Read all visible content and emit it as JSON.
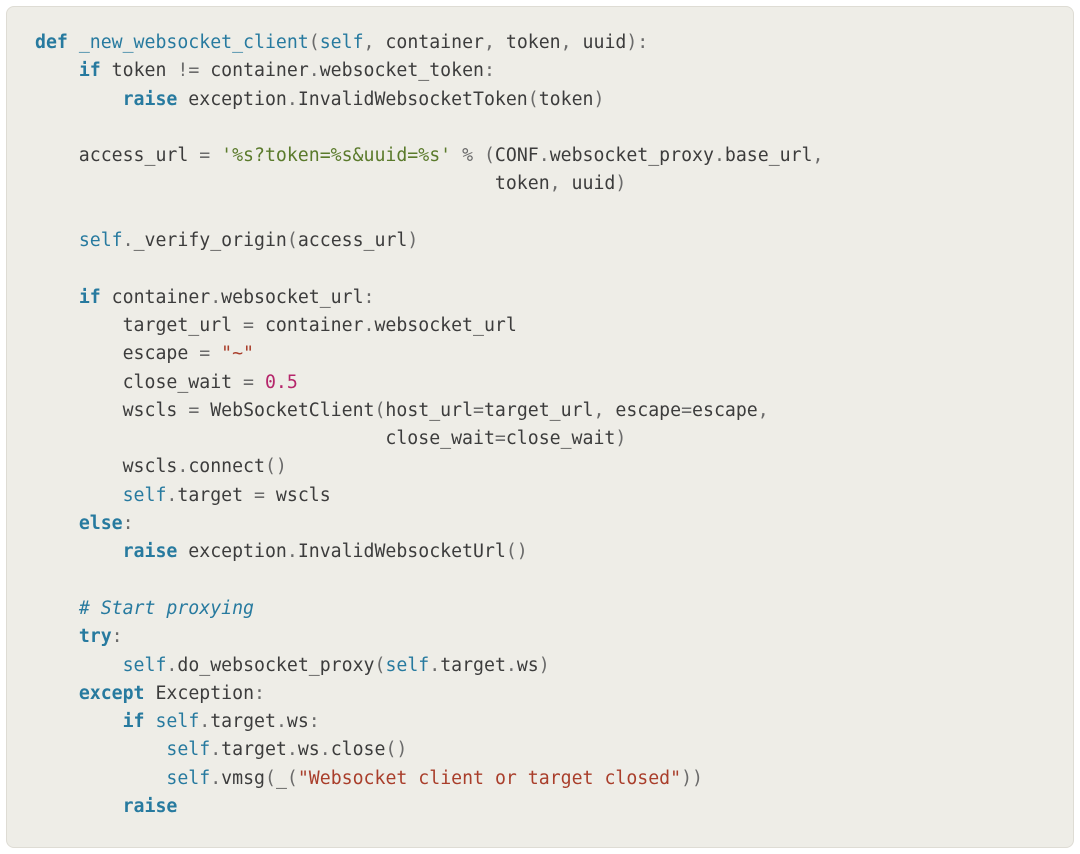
{
  "code": {
    "lines": [
      [
        {
          "cls": "kw",
          "t": "def"
        },
        {
          "cls": "",
          "t": " "
        },
        {
          "cls": "fn",
          "t": "_new_websocket_client"
        },
        {
          "cls": "pa",
          "t": "("
        },
        {
          "cls": "bn",
          "t": "self"
        },
        {
          "cls": "op",
          "t": ","
        },
        {
          "cls": "",
          "t": " container"
        },
        {
          "cls": "op",
          "t": ","
        },
        {
          "cls": "",
          "t": " token"
        },
        {
          "cls": "op",
          "t": ","
        },
        {
          "cls": "",
          "t": " uuid"
        },
        {
          "cls": "pa",
          "t": ")"
        },
        {
          "cls": "op",
          "t": ":"
        }
      ],
      [
        {
          "cls": "",
          "t": "    "
        },
        {
          "cls": "kw",
          "t": "if"
        },
        {
          "cls": "",
          "t": " token "
        },
        {
          "cls": "op",
          "t": "!="
        },
        {
          "cls": "",
          "t": " container"
        },
        {
          "cls": "op",
          "t": "."
        },
        {
          "cls": "",
          "t": "websocket_token"
        },
        {
          "cls": "op",
          "t": ":"
        }
      ],
      [
        {
          "cls": "",
          "t": "        "
        },
        {
          "cls": "kw",
          "t": "raise"
        },
        {
          "cls": "",
          "t": " exception"
        },
        {
          "cls": "op",
          "t": "."
        },
        {
          "cls": "",
          "t": "InvalidWebsocketToken"
        },
        {
          "cls": "pa",
          "t": "("
        },
        {
          "cls": "",
          "t": "token"
        },
        {
          "cls": "pa",
          "t": ")"
        }
      ],
      [
        {
          "cls": "",
          "t": ""
        }
      ],
      [
        {
          "cls": "",
          "t": "    access_url "
        },
        {
          "cls": "op",
          "t": "="
        },
        {
          "cls": "",
          "t": " "
        },
        {
          "cls": "s1",
          "t": "'%s?token=%s&uuid=%s'"
        },
        {
          "cls": "",
          "t": " "
        },
        {
          "cls": "op",
          "t": "%"
        },
        {
          "cls": "",
          "t": " "
        },
        {
          "cls": "pa",
          "t": "("
        },
        {
          "cls": "",
          "t": "CONF"
        },
        {
          "cls": "op",
          "t": "."
        },
        {
          "cls": "",
          "t": "websocket_proxy"
        },
        {
          "cls": "op",
          "t": "."
        },
        {
          "cls": "",
          "t": "base_url"
        },
        {
          "cls": "op",
          "t": ","
        }
      ],
      [
        {
          "cls": "",
          "t": "                                          token"
        },
        {
          "cls": "op",
          "t": ","
        },
        {
          "cls": "",
          "t": " uuid"
        },
        {
          "cls": "pa",
          "t": ")"
        }
      ],
      [
        {
          "cls": "",
          "t": ""
        }
      ],
      [
        {
          "cls": "",
          "t": "    "
        },
        {
          "cls": "bn",
          "t": "self"
        },
        {
          "cls": "op",
          "t": "."
        },
        {
          "cls": "",
          "t": "_verify_origin"
        },
        {
          "cls": "pa",
          "t": "("
        },
        {
          "cls": "",
          "t": "access_url"
        },
        {
          "cls": "pa",
          "t": ")"
        }
      ],
      [
        {
          "cls": "",
          "t": ""
        }
      ],
      [
        {
          "cls": "",
          "t": "    "
        },
        {
          "cls": "kw",
          "t": "if"
        },
        {
          "cls": "",
          "t": " container"
        },
        {
          "cls": "op",
          "t": "."
        },
        {
          "cls": "",
          "t": "websocket_url"
        },
        {
          "cls": "op",
          "t": ":"
        }
      ],
      [
        {
          "cls": "",
          "t": "        target_url "
        },
        {
          "cls": "op",
          "t": "="
        },
        {
          "cls": "",
          "t": " container"
        },
        {
          "cls": "op",
          "t": "."
        },
        {
          "cls": "",
          "t": "websocket_url"
        }
      ],
      [
        {
          "cls": "",
          "t": "        escape "
        },
        {
          "cls": "op",
          "t": "="
        },
        {
          "cls": "",
          "t": " "
        },
        {
          "cls": "s2",
          "t": "\"~\""
        }
      ],
      [
        {
          "cls": "",
          "t": "        close_wait "
        },
        {
          "cls": "op",
          "t": "="
        },
        {
          "cls": "",
          "t": " "
        },
        {
          "cls": "nm",
          "t": "0.5"
        }
      ],
      [
        {
          "cls": "",
          "t": "        wscls "
        },
        {
          "cls": "op",
          "t": "="
        },
        {
          "cls": "",
          "t": " WebSocketClient"
        },
        {
          "cls": "pa",
          "t": "("
        },
        {
          "cls": "",
          "t": "host_url"
        },
        {
          "cls": "op",
          "t": "="
        },
        {
          "cls": "",
          "t": "target_url"
        },
        {
          "cls": "op",
          "t": ","
        },
        {
          "cls": "",
          "t": " escape"
        },
        {
          "cls": "op",
          "t": "="
        },
        {
          "cls": "",
          "t": "escape"
        },
        {
          "cls": "op",
          "t": ","
        }
      ],
      [
        {
          "cls": "",
          "t": "                                close_wait"
        },
        {
          "cls": "op",
          "t": "="
        },
        {
          "cls": "",
          "t": "close_wait"
        },
        {
          "cls": "pa",
          "t": ")"
        }
      ],
      [
        {
          "cls": "",
          "t": "        wscls"
        },
        {
          "cls": "op",
          "t": "."
        },
        {
          "cls": "",
          "t": "connect"
        },
        {
          "cls": "pa",
          "t": "()"
        }
      ],
      [
        {
          "cls": "",
          "t": "        "
        },
        {
          "cls": "bn",
          "t": "self"
        },
        {
          "cls": "op",
          "t": "."
        },
        {
          "cls": "",
          "t": "target "
        },
        {
          "cls": "op",
          "t": "="
        },
        {
          "cls": "",
          "t": " wscls"
        }
      ],
      [
        {
          "cls": "",
          "t": "    "
        },
        {
          "cls": "kw",
          "t": "else"
        },
        {
          "cls": "op",
          "t": ":"
        }
      ],
      [
        {
          "cls": "",
          "t": "        "
        },
        {
          "cls": "kw",
          "t": "raise"
        },
        {
          "cls": "",
          "t": " exception"
        },
        {
          "cls": "op",
          "t": "."
        },
        {
          "cls": "",
          "t": "InvalidWebsocketUrl"
        },
        {
          "cls": "pa",
          "t": "()"
        }
      ],
      [
        {
          "cls": "",
          "t": ""
        }
      ],
      [
        {
          "cls": "",
          "t": "    "
        },
        {
          "cls": "cm",
          "t": "# Start proxying"
        }
      ],
      [
        {
          "cls": "",
          "t": "    "
        },
        {
          "cls": "kw",
          "t": "try"
        },
        {
          "cls": "op",
          "t": ":"
        }
      ],
      [
        {
          "cls": "",
          "t": "        "
        },
        {
          "cls": "bn",
          "t": "self"
        },
        {
          "cls": "op",
          "t": "."
        },
        {
          "cls": "",
          "t": "do_websocket_proxy"
        },
        {
          "cls": "pa",
          "t": "("
        },
        {
          "cls": "bn",
          "t": "self"
        },
        {
          "cls": "op",
          "t": "."
        },
        {
          "cls": "",
          "t": "target"
        },
        {
          "cls": "op",
          "t": "."
        },
        {
          "cls": "",
          "t": "ws"
        },
        {
          "cls": "pa",
          "t": ")"
        }
      ],
      [
        {
          "cls": "",
          "t": "    "
        },
        {
          "cls": "kw",
          "t": "except"
        },
        {
          "cls": "",
          "t": " "
        },
        {
          "cls": "",
          "t": "Exception"
        },
        {
          "cls": "op",
          "t": ":"
        }
      ],
      [
        {
          "cls": "",
          "t": "        "
        },
        {
          "cls": "kw",
          "t": "if"
        },
        {
          "cls": "",
          "t": " "
        },
        {
          "cls": "bn",
          "t": "self"
        },
        {
          "cls": "op",
          "t": "."
        },
        {
          "cls": "",
          "t": "target"
        },
        {
          "cls": "op",
          "t": "."
        },
        {
          "cls": "",
          "t": "ws"
        },
        {
          "cls": "op",
          "t": ":"
        }
      ],
      [
        {
          "cls": "",
          "t": "            "
        },
        {
          "cls": "bn",
          "t": "self"
        },
        {
          "cls": "op",
          "t": "."
        },
        {
          "cls": "",
          "t": "target"
        },
        {
          "cls": "op",
          "t": "."
        },
        {
          "cls": "",
          "t": "ws"
        },
        {
          "cls": "op",
          "t": "."
        },
        {
          "cls": "",
          "t": "close"
        },
        {
          "cls": "pa",
          "t": "()"
        }
      ],
      [
        {
          "cls": "",
          "t": "            "
        },
        {
          "cls": "bn",
          "t": "self"
        },
        {
          "cls": "op",
          "t": "."
        },
        {
          "cls": "",
          "t": "vmsg"
        },
        {
          "cls": "pa",
          "t": "("
        },
        {
          "cls": "",
          "t": "_"
        },
        {
          "cls": "pa",
          "t": "("
        },
        {
          "cls": "s2",
          "t": "\"Websocket client or target closed\""
        },
        {
          "cls": "pa",
          "t": ")"
        },
        {
          "cls": "pa",
          "t": ")"
        }
      ],
      [
        {
          "cls": "",
          "t": "        "
        },
        {
          "cls": "kw",
          "t": "raise"
        }
      ]
    ]
  }
}
